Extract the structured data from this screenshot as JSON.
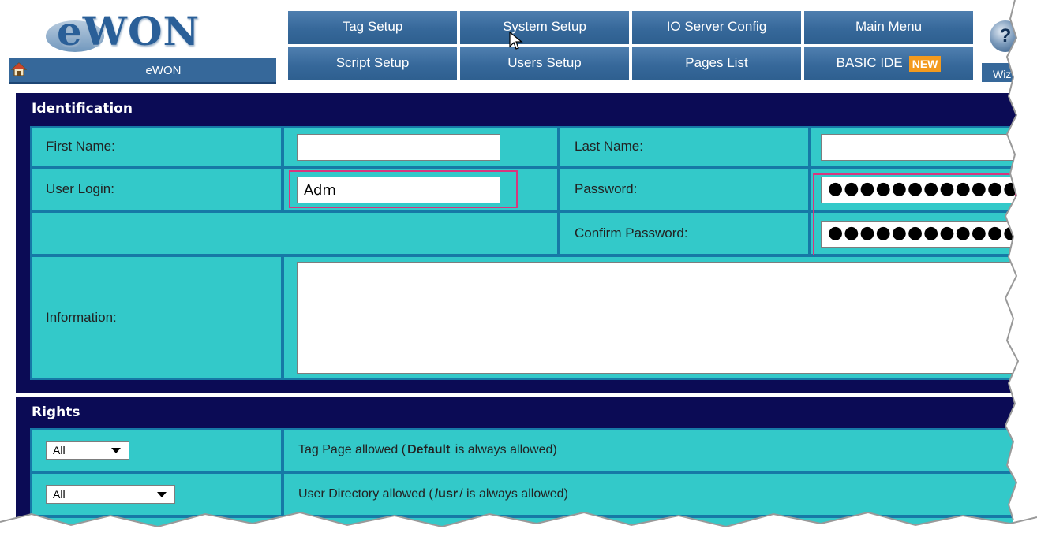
{
  "app": {
    "logo_text": "eWON",
    "home_label": "eWON",
    "help_tab_label": "Wiz"
  },
  "nav": {
    "items": [
      {
        "label": "Tag Setup"
      },
      {
        "label": "System Setup"
      },
      {
        "label": "IO Server Config"
      },
      {
        "label": "Main Menu"
      },
      {
        "label": "Script Setup"
      },
      {
        "label": "Users Setup"
      },
      {
        "label": "Pages List"
      },
      {
        "label": "BASIC IDE",
        "badge": "NEW"
      }
    ]
  },
  "identification": {
    "title": "Identification",
    "first_name_label": "First Name:",
    "first_name_value": "",
    "last_name_label": "Last Name:",
    "last_name_value": "",
    "user_login_label": "User Login:",
    "user_login_value": "Adm",
    "password_label": "Password:",
    "password_value": "●●●●●●●●●●●●●●●●",
    "confirm_password_label": "Confirm Password:",
    "confirm_password_value": "●●●●●●●●●●●●●●●●",
    "information_label": "Information:",
    "information_value": ""
  },
  "rights": {
    "title": "Rights",
    "rows": [
      {
        "select_value": "All",
        "text_pre": "Tag Page allowed (",
        "text_bold": "Default",
        "text_post": " is always allowed)"
      },
      {
        "select_value": "All",
        "text_pre": "User Directory allowed (",
        "text_bold": "/usr",
        "text_post": "/ is always allowed)"
      }
    ]
  },
  "colors": {
    "nav_blue": "#36689a",
    "section_navy": "#0b0b55",
    "cell_teal": "#33c9c9",
    "highlight_pink": "#d8367e",
    "badge_orange": "#f39a1e"
  }
}
